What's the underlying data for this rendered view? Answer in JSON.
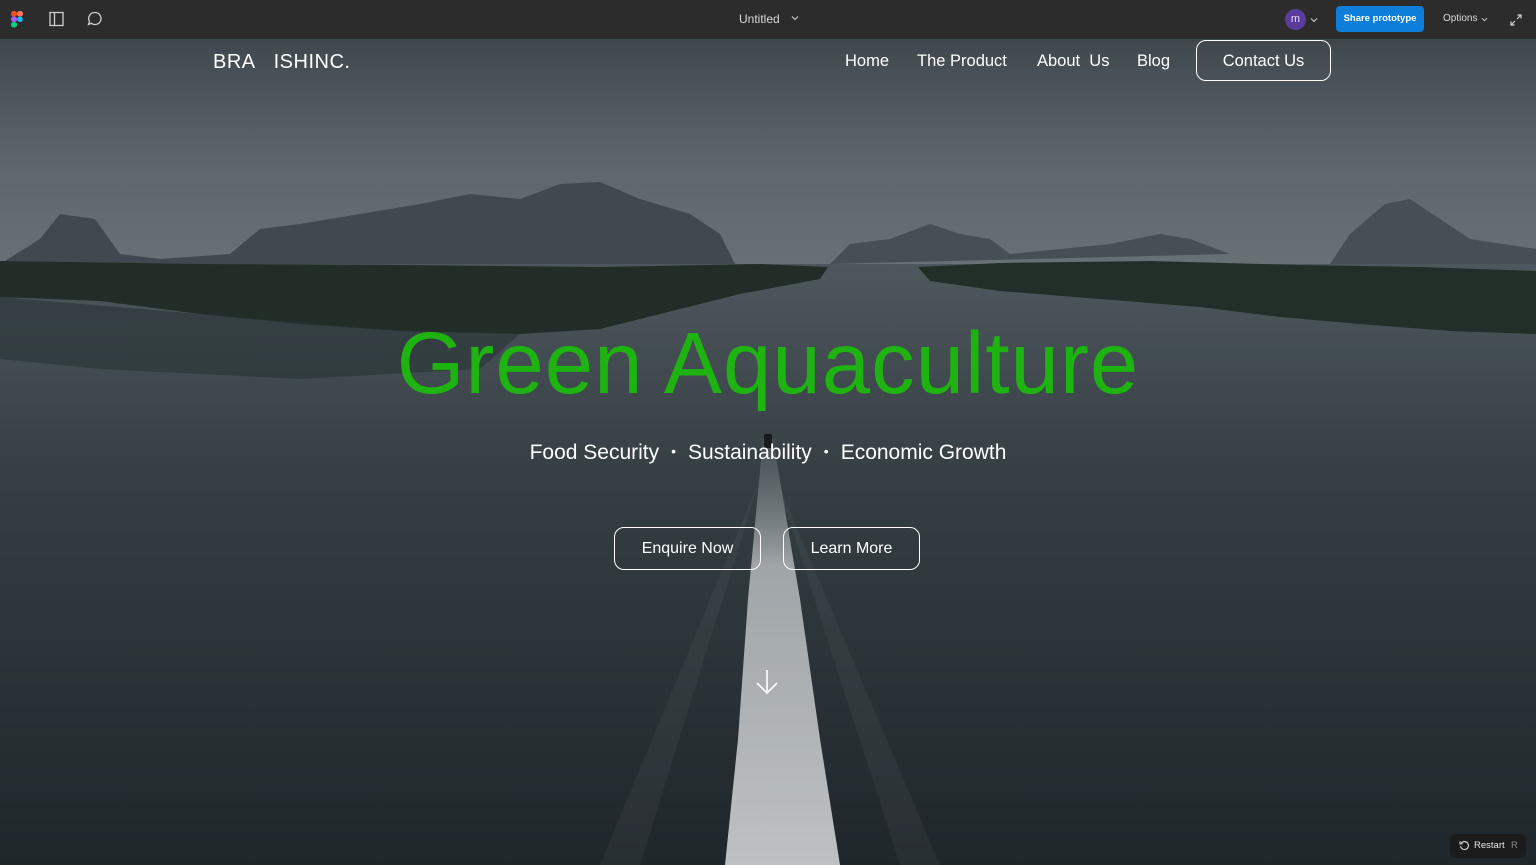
{
  "prototype_bar": {
    "file_title": "Untitled",
    "avatar_initial": "m",
    "share_label": "Share prototype",
    "options_label": "Options",
    "icons": [
      "figma-logo",
      "sidebar-toggle-icon",
      "comment-icon",
      "collapse-icon"
    ],
    "share_color": "#0d7fdb"
  },
  "site": {
    "logo_left": "BRA",
    "logo_right": "ISHINC.",
    "nav": {
      "home": "Home",
      "product": "The Product",
      "about": "About  Us",
      "blog": "Blog",
      "contact": "Contact Us"
    }
  },
  "hero": {
    "title": "Green Aquaculture",
    "title_color": "#1fb311",
    "tagline": [
      "Food Security",
      "Sustainability",
      "Economic Growth"
    ],
    "separator": "•",
    "buttons": {
      "enquire": "Enquire Now",
      "learn": "Learn More"
    },
    "scroll_icon": "arrow-down-icon"
  },
  "restart": {
    "label": "Restart",
    "shortcut": "R"
  }
}
